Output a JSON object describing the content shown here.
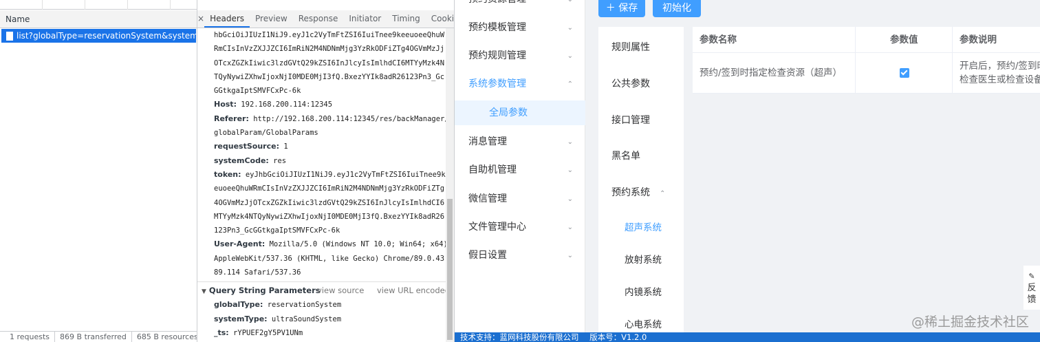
{
  "devtools": {
    "name_header": "Name",
    "request": "list?globalType=reservationSystem&systemType=...",
    "status": [
      "1 requests",
      "869 B transferred",
      "685 B resources"
    ],
    "tabs": [
      "×",
      "Headers",
      "Preview",
      "Response",
      "Initiator",
      "Timing",
      "Cookies"
    ],
    "headers_lines": [
      {
        "k": "",
        "v": "hbGciOiJIUzI1NiJ9.eyJ1c2VyTmFtZSI6IuiTnee9keeuoeeQhuW"
      },
      {
        "k": "",
        "v": "RmCIsInVzZXJJZCI6ImRiN2M4NDNmMjg3YzRkODFiZTg4OGVmMzJj"
      },
      {
        "k": "",
        "v": "OTcxZGZkIiwic3lzdGVtQ29kZSI6InJlcyIsImlhdCI6MTYyMzk4N"
      },
      {
        "k": "",
        "v": "TQyNywiZXhwIjoxNjI0MDE0MjI3fQ.BxezYYIk8adR26123Pn3_Gc"
      },
      {
        "k": "",
        "v": "GGtkgaIptSMVFCxPc-6k"
      },
      {
        "k": "Host:",
        "v": "192.168.200.114:12345"
      },
      {
        "k": "Referer:",
        "v": "http://192.168.200.114:12345/res/backManager/"
      },
      {
        "k": "",
        "v": "globalParam/GlobalParams"
      },
      {
        "k": "requestSource:",
        "v": "1"
      },
      {
        "k": "systemCode:",
        "v": "res"
      },
      {
        "k": "token:",
        "v": "eyJhbGciOiJIUzI1NiJ9.eyJ1c2VyTmFtZSI6IuiTnee9ke"
      },
      {
        "k": "",
        "v": "euoeeQhuWRmCIsInVzZXJJZCI6ImRiN2M4NDNmMjg3YzRkODFiZTg"
      },
      {
        "k": "",
        "v": "4OGVmMzJjOTcxZGZkIiwic3lzdGVtQ29kZSI6InJlcyIsImlhdCI6"
      },
      {
        "k": "",
        "v": "MTYyMzk4NTQyNywiZXhwIjoxNjI0MDE0MjI3fQ.BxezYYIk8adR26"
      },
      {
        "k": "",
        "v": "123Pn3_GcGGtkgaIptSMVFCxPc-6k"
      },
      {
        "k": "User-Agent:",
        "v": "Mozilla/5.0 (Windows NT 10.0; Win64; x64)"
      },
      {
        "k": "",
        "v": "AppleWebKit/537.36 (KHTML, like Gecko) Chrome/89.0.43"
      },
      {
        "k": "",
        "v": "89.114 Safari/537.36"
      }
    ],
    "qsp": {
      "title": "Query String Parameters",
      "view_source": "view source",
      "view_url": "view URL encoded",
      "params": [
        {
          "k": "globalType:",
          "v": "reservationSystem"
        },
        {
          "k": "systemType:",
          "v": "ultraSoundSystem"
        },
        {
          "k": "_ts:",
          "v": "rYPUEF2gY5PV1UNm"
        }
      ]
    }
  },
  "sidebar": {
    "items": [
      {
        "label": "预约资源管理",
        "chev": "⌄"
      },
      {
        "label": "预约模板管理",
        "chev": "⌄"
      },
      {
        "label": "预约规则管理",
        "chev": "⌄"
      },
      {
        "label": "系统参数管理",
        "chev": "⌃"
      },
      {
        "label": "全局参数"
      },
      {
        "label": "消息管理",
        "chev": "⌄"
      },
      {
        "label": "自助机管理",
        "chev": "⌄"
      },
      {
        "label": "微信管理",
        "chev": "⌄"
      },
      {
        "label": "文件管理中心",
        "chev": "⌄"
      },
      {
        "label": "假日设置",
        "chev": "⌄"
      }
    ]
  },
  "toolbar": {
    "save_label": "＋ 保存",
    "init_label": "初始化"
  },
  "vtabs": [
    {
      "label": "规则属性"
    },
    {
      "label": "公共参数"
    },
    {
      "label": "接口管理"
    },
    {
      "label": "黑名单"
    },
    {
      "label": "预约系统",
      "chev": "⌃"
    },
    {
      "label": "超声系统"
    },
    {
      "label": "放射系统"
    },
    {
      "label": "内镜系统"
    },
    {
      "label": "心电系统"
    }
  ],
  "table": {
    "headers": [
      "参数名称",
      "参数值",
      "参数说明"
    ],
    "rows": [
      {
        "name": "预约/签到时指定检查资源（超声）",
        "checked": true,
        "desc1": "开启后，预约/签到时",
        "desc2": "检查医生或检查设备"
      }
    ]
  },
  "feedback": {
    "icon": "✎",
    "line1": "反",
    "line2": "馈"
  },
  "footer": {
    "support": "技术支持：蓝网科技股份有限公司",
    "version": "版本号：V1.2.0"
  },
  "watermark": "@稀土掘金技术社区",
  "colors": {
    "accent": "#409eff",
    "devtools_select": "#1a73e8",
    "footer": "#1b6fd0"
  }
}
